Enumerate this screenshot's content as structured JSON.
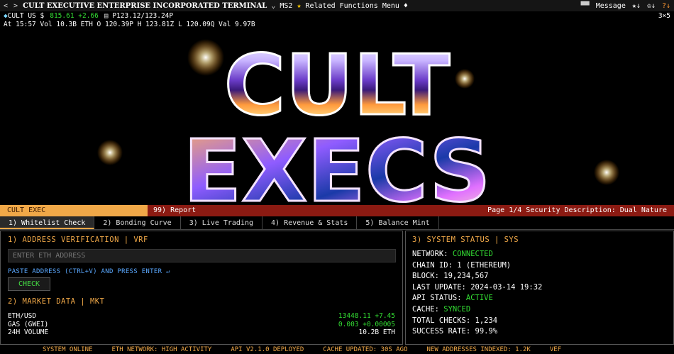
{
  "topbar": {
    "nav": "< >",
    "title": "CULT EXECUTIVE ENTERPRISE INCORPORATED TERMINAL",
    "chevron": "⌄",
    "ms2": "MS2",
    "menu": "Related Functions Menu",
    "menu_arrow": "♦",
    "message": "Message",
    "icon_star": "★↓",
    "icon_user": "♔↓",
    "icon_help": "?↓"
  },
  "ticker": {
    "symbol": "CULT US $",
    "price": "815.61 +2.66",
    "range": "P123.12/123.24P",
    "layout": "3×5",
    "line2": "At 15:57 Vol 10.3B ETH O 120.39P H 123.81Z L 120.09Q Val 9.97B"
  },
  "hero": {
    "line1": "CULT",
    "line2": "EXECS"
  },
  "titlebar": {
    "left": "CULT EXEC",
    "report": "99) Report",
    "page": "Page 1/4 Security Description: Dual Nature"
  },
  "tabs": [
    "1) Whitelist Check",
    "2) Bonding Curve",
    "3) Live Trading",
    "4) Revenue & Stats",
    "5) Balance Mint"
  ],
  "verify": {
    "title": "1) ADDRESS VERIFICATION | VRF",
    "placeholder": "ENTER ETH ADDRESS",
    "hint": "PASTE ADDRESS (CTRL+V) AND PRESS ENTER ↵",
    "button": "CHECK"
  },
  "market": {
    "title": "2) MARKET DATA | MKT",
    "rows": [
      {
        "label": "ETH/USD",
        "value": "13448.11 +7.45"
      },
      {
        "label": "GAS (GWEI)",
        "value": "0.003 +0.00005"
      },
      {
        "label": "24H VOLUME",
        "value": "10.2B ETH"
      }
    ]
  },
  "system": {
    "title": "3) SYSTEM STATUS | SYS",
    "rows": [
      {
        "label": "NETWORK:",
        "value": "CONNECTED"
      },
      {
        "label": "CHAIN ID:",
        "value": "1 (ETHEREUM)"
      },
      {
        "label": "BLOCK:",
        "value": "19,234,567"
      },
      {
        "label": "LAST UPDATE:",
        "value": "2024-03-14 19:32"
      },
      {
        "label": "API STATUS:",
        "value": "ACTIVE"
      },
      {
        "label": "CACHE:",
        "value": "SYNCED"
      },
      {
        "label": "TOTAL CHECKS:",
        "value": "1,234"
      },
      {
        "label": "SUCCESS RATE:",
        "value": "99.9%"
      }
    ]
  },
  "statusbar": [
    "SYSTEM ONLINE",
    "ETH NETWORK: HIGH ACTIVITY",
    "API V2.1.0 DEPLOYED",
    "CACHE UPDATED: 30S AGO",
    "NEW ADDRESSES INDEXED: 1.2K",
    "VEF"
  ],
  "colors": {
    "accent": "#f0a848",
    "report_bg": "#8b1a12",
    "ok": "#33dd33",
    "hint": "#5aa8ff"
  }
}
